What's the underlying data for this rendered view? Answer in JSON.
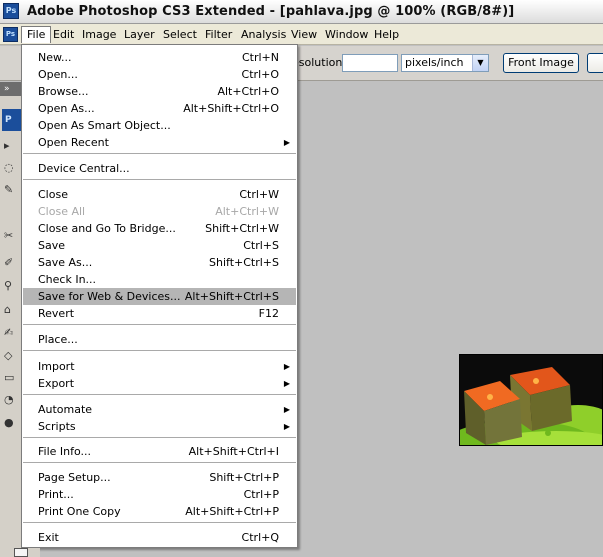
{
  "window": {
    "title": "Adobe Photoshop CS3 Extended - [pahlava.jpg @ 100% (RGB/8#)]",
    "app_icon": "Ps"
  },
  "menubar": {
    "icon": "Ps",
    "items": [
      "File",
      "Edit",
      "Image",
      "Layer",
      "Select",
      "Filter",
      "Analysis",
      "View",
      "Window",
      "Help"
    ]
  },
  "options_bar": {
    "resolution_label": "esolution:",
    "resolution_value": "",
    "units_selected": "pixels/inch",
    "front_image_button": "Front Image"
  },
  "toolbox": {
    "logo": "P"
  },
  "file_menu": {
    "items": [
      {
        "label": "New...",
        "shortcut": "Ctrl+N"
      },
      {
        "label": "Open...",
        "shortcut": "Ctrl+O"
      },
      {
        "label": "Browse...",
        "shortcut": "Alt+Ctrl+O"
      },
      {
        "label": "Open As...",
        "shortcut": "Alt+Shift+Ctrl+O"
      },
      {
        "label": "Open As Smart Object...",
        "shortcut": ""
      },
      {
        "label": "Open Recent",
        "shortcut": "",
        "submenu": true
      },
      {
        "label": "Device Central...",
        "shortcut": ""
      },
      {
        "label": "Close",
        "shortcut": "Ctrl+W"
      },
      {
        "label": "Close All",
        "shortcut": "Alt+Ctrl+W",
        "disabled": true
      },
      {
        "label": "Close and Go To Bridge...",
        "shortcut": "Shift+Ctrl+W"
      },
      {
        "label": "Save",
        "shortcut": "Ctrl+S"
      },
      {
        "label": "Save As...",
        "shortcut": "Shift+Ctrl+S"
      },
      {
        "label": "Check In...",
        "shortcut": ""
      },
      {
        "label": "Save for Web & Devices...",
        "shortcut": "Alt+Shift+Ctrl+S",
        "highlighted": true
      },
      {
        "label": "Revert",
        "shortcut": "F12"
      },
      {
        "label": "Place...",
        "shortcut": ""
      },
      {
        "label": "Import",
        "shortcut": "",
        "submenu": true
      },
      {
        "label": "Export",
        "shortcut": "",
        "submenu": true
      },
      {
        "label": "Automate",
        "shortcut": "",
        "submenu": true
      },
      {
        "label": "Scripts",
        "shortcut": "",
        "submenu": true
      },
      {
        "label": "File Info...",
        "shortcut": "Alt+Shift+Ctrl+I"
      },
      {
        "label": "Page Setup...",
        "shortcut": "Shift+Ctrl+P"
      },
      {
        "label": "Print...",
        "shortcut": "Ctrl+P"
      },
      {
        "label": "Print One Copy",
        "shortcut": "Alt+Shift+Ctrl+P"
      },
      {
        "label": "Exit",
        "shortcut": "Ctrl+Q"
      }
    ]
  },
  "colors": {
    "highlight": "#b5b5b5",
    "disabled_text": "#a7a7a7",
    "canvas": "#c0c0c0"
  }
}
